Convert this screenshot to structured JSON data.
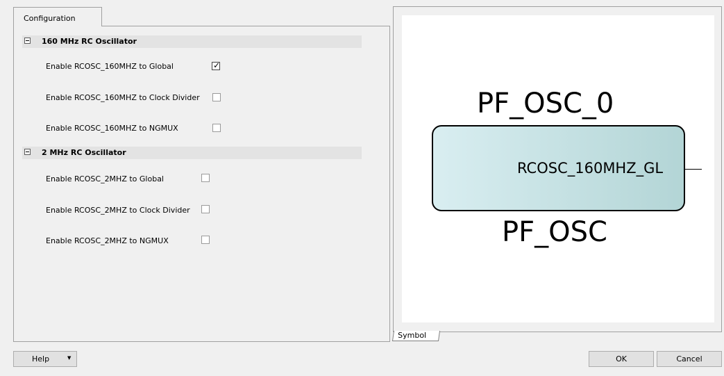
{
  "config_tab": {
    "label": "Configuration"
  },
  "sections": [
    {
      "title": "160 MHz RC Oscillator",
      "options": [
        {
          "label": "Enable RCOSC_160MHZ to Global",
          "checked": true
        },
        {
          "label": "Enable RCOSC_160MHZ to Clock Divider",
          "checked": false
        },
        {
          "label": "Enable RCOSC_160MHZ to NGMUX",
          "checked": false
        }
      ]
    },
    {
      "title": "2 MHz RC Oscillator",
      "options": [
        {
          "label": "Enable RCOSC_2MHZ to Global",
          "checked": false
        },
        {
          "label": "Enable RCOSC_2MHZ to Clock Divider",
          "checked": false
        },
        {
          "label": "Enable RCOSC_2MHZ to NGMUX",
          "checked": false
        }
      ]
    }
  ],
  "symbol": {
    "instance_name": "PF_OSC_0",
    "component_name": "PF_OSC",
    "port": "RCOSC_160MHZ_GL",
    "fill_color_start": "#d9eef1",
    "fill_color_end": "#b3d5d6"
  },
  "symbol_tab": {
    "label": "Symbol"
  },
  "buttons": {
    "help": "Help",
    "ok": "OK",
    "cancel": "Cancel"
  },
  "checkmark_glyph": "✓"
}
